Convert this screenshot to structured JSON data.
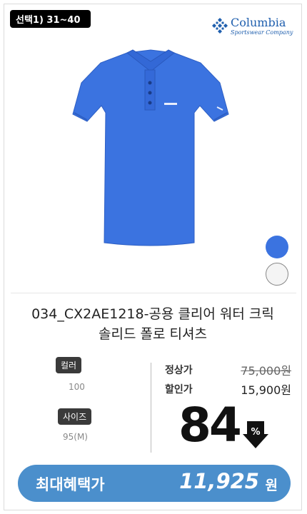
{
  "badge": {
    "label": "선택1) 31~40"
  },
  "brand": {
    "name": "Columbia",
    "tagline": "Sportswear Company"
  },
  "product": {
    "name_line1": "034_CX2AE1218-공용 클리어 워터 크릭",
    "name_line2": "솔리드 폴로 티셔츠"
  },
  "swatches": [
    {
      "color": "#3b73e0"
    },
    {
      "color": "#f4f4f4"
    }
  ],
  "options": {
    "color_label": "컬러",
    "color_value": "100",
    "size_label": "사이즈",
    "size_value": "95(M)"
  },
  "price": {
    "regular_label": "정상가",
    "regular_value": "75,000원",
    "sale_label": "할인가",
    "sale_value": "15,900원",
    "discount": "84",
    "discount_unit": "%"
  },
  "benefit": {
    "label": "최대혜택가",
    "price": "11,925",
    "unit": "원"
  }
}
